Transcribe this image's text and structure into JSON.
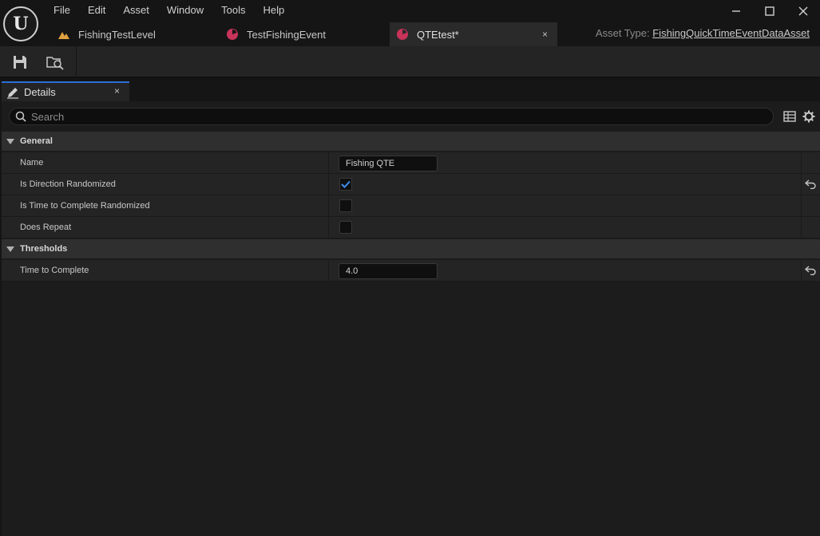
{
  "menu": [
    "File",
    "Edit",
    "Asset",
    "Window",
    "Tools",
    "Help"
  ],
  "tabs": [
    {
      "label": "FishingTestLevel"
    },
    {
      "label": "TestFishingEvent"
    },
    {
      "label": "QTEtest*",
      "close": "×"
    }
  ],
  "asset_type": {
    "label": "Asset Type:",
    "value": "FishingQuickTimeEventDataAsset"
  },
  "panel": {
    "title": "Details",
    "close": "×"
  },
  "search": {
    "placeholder": "Search",
    "value": ""
  },
  "categories": [
    {
      "label": "General",
      "properties": [
        {
          "name": "Name",
          "type": "text",
          "value": "Fishing QTE",
          "modified": false
        },
        {
          "name": "Is Direction Randomized",
          "type": "checkbox",
          "checked": true,
          "modified": true
        },
        {
          "name": "Is Time to Complete Randomized",
          "type": "checkbox",
          "checked": false,
          "modified": false
        },
        {
          "name": "Does Repeat",
          "type": "checkbox",
          "checked": false,
          "modified": false
        }
      ]
    },
    {
      "label": "Thresholds",
      "properties": [
        {
          "name": "Time to Complete",
          "type": "text",
          "value": "4.0",
          "modified": true
        }
      ]
    }
  ],
  "colors": {
    "accent": "#2b6fd6",
    "blueprint_icon": "#c8335a",
    "level_icon": "#e0a040",
    "check": "#3a8ff0"
  }
}
